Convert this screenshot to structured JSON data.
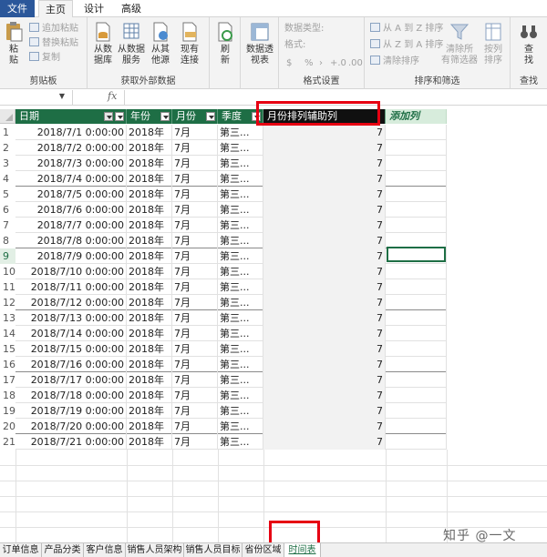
{
  "ribbon_tabs": [
    {
      "label": "文件"
    },
    {
      "label": "主页"
    },
    {
      "label": "设计"
    },
    {
      "label": "高级"
    }
  ],
  "ribbon": {
    "clipboard": {
      "paste_label": "粘",
      "paste_label2": "贴",
      "append_paste": "追加粘贴",
      "replace_paste": "替换粘贴",
      "copy": "复制",
      "group_label": "剪贴板"
    },
    "external": {
      "from_db_1": "从数",
      "from_db_2": "据库",
      "from_data_service_1": "从数据",
      "from_data_service_2": "服务",
      "from_other_1": "从其",
      "from_other_2": "他源",
      "existing_1": "现有",
      "existing_2": "连接",
      "group_label": "获取外部数据"
    },
    "refresh": {
      "label_1": "刷",
      "label_2": "新"
    },
    "pivot": {
      "label_1": "数据透",
      "label_2": "视表"
    },
    "format": {
      "data_type": "数据类型:",
      "format": "格式:",
      "currency": "$",
      "percent": "%",
      "comma": "›",
      "inc": "+.0",
      "dec": ".00",
      "group_label": "格式设置"
    },
    "sort": {
      "a_to_z": "从 A 到 Z 排序",
      "z_to_a": "从 Z 到 A 排序",
      "clear_sort": "清除排序",
      "clear_filters_1": "清除所",
      "clear_filters_2": "有筛选器",
      "sort_by_col_1": "按列",
      "sort_by_col_2": "排序",
      "group_label": "排序和筛选"
    },
    "find": {
      "label_1": "查",
      "label_2": "找",
      "group_label": "查找"
    }
  },
  "formula_bar": {
    "fx": "fx",
    "dropdown": "▼"
  },
  "table": {
    "headers": [
      "日期",
      "年份",
      "月份",
      "季度",
      "月份排列辅助列",
      "添加列"
    ],
    "rows": [
      {
        "n": "1",
        "date": "2018/7/1 0:00:00",
        "year": "2018年",
        "month": "7月",
        "quarter": "第三...",
        "helper": "7"
      },
      {
        "n": "2",
        "date": "2018/7/2 0:00:00",
        "year": "2018年",
        "month": "7月",
        "quarter": "第三...",
        "helper": "7"
      },
      {
        "n": "3",
        "date": "2018/7/3 0:00:00",
        "year": "2018年",
        "month": "7月",
        "quarter": "第三...",
        "helper": "7"
      },
      {
        "n": "4",
        "date": "2018/7/4 0:00:00",
        "year": "2018年",
        "month": "7月",
        "quarter": "第三...",
        "helper": "7"
      },
      {
        "n": "5",
        "date": "2018/7/5 0:00:00",
        "year": "2018年",
        "month": "7月",
        "quarter": "第三...",
        "helper": "7"
      },
      {
        "n": "6",
        "date": "2018/7/6 0:00:00",
        "year": "2018年",
        "month": "7月",
        "quarter": "第三...",
        "helper": "7"
      },
      {
        "n": "7",
        "date": "2018/7/7 0:00:00",
        "year": "2018年",
        "month": "7月",
        "quarter": "第三...",
        "helper": "7"
      },
      {
        "n": "8",
        "date": "2018/7/8 0:00:00",
        "year": "2018年",
        "month": "7月",
        "quarter": "第三...",
        "helper": "7"
      },
      {
        "n": "9",
        "date": "2018/7/9 0:00:00",
        "year": "2018年",
        "month": "7月",
        "quarter": "第三...",
        "helper": "7"
      },
      {
        "n": "10",
        "date": "2018/7/10 0:00:00",
        "year": "2018年",
        "month": "7月",
        "quarter": "第三...",
        "helper": "7"
      },
      {
        "n": "11",
        "date": "2018/7/11 0:00:00",
        "year": "2018年",
        "month": "7月",
        "quarter": "第三...",
        "helper": "7"
      },
      {
        "n": "12",
        "date": "2018/7/12 0:00:00",
        "year": "2018年",
        "month": "7月",
        "quarter": "第三...",
        "helper": "7"
      },
      {
        "n": "13",
        "date": "2018/7/13 0:00:00",
        "year": "2018年",
        "month": "7月",
        "quarter": "第三...",
        "helper": "7"
      },
      {
        "n": "14",
        "date": "2018/7/14 0:00:00",
        "year": "2018年",
        "month": "7月",
        "quarter": "第三...",
        "helper": "7"
      },
      {
        "n": "15",
        "date": "2018/7/15 0:00:00",
        "year": "2018年",
        "month": "7月",
        "quarter": "第三...",
        "helper": "7"
      },
      {
        "n": "16",
        "date": "2018/7/16 0:00:00",
        "year": "2018年",
        "month": "7月",
        "quarter": "第三...",
        "helper": "7"
      },
      {
        "n": "17",
        "date": "2018/7/17 0:00:00",
        "year": "2018年",
        "month": "7月",
        "quarter": "第三...",
        "helper": "7"
      },
      {
        "n": "18",
        "date": "2018/7/18 0:00:00",
        "year": "2018年",
        "month": "7月",
        "quarter": "第三...",
        "helper": "7"
      },
      {
        "n": "19",
        "date": "2018/7/19 0:00:00",
        "year": "2018年",
        "month": "7月",
        "quarter": "第三...",
        "helper": "7"
      },
      {
        "n": "20",
        "date": "2018/7/20 0:00:00",
        "year": "2018年",
        "month": "7月",
        "quarter": "第三...",
        "helper": "7"
      },
      {
        "n": "21",
        "date": "2018/7/21 0:00:00",
        "year": "2018年",
        "month": "7月",
        "quarter": "第三...",
        "helper": "7"
      }
    ],
    "selected_row": "9"
  },
  "sheet_tabs": [
    {
      "label": "订单信息"
    },
    {
      "label": "产品分类"
    },
    {
      "label": "客户信息"
    },
    {
      "label": "销售人员架构"
    },
    {
      "label": "销售人员目标"
    },
    {
      "label": "省份区域"
    },
    {
      "label": "时间表"
    }
  ],
  "active_sheet": "时间表",
  "watermark": "知乎 @一文",
  "colors": {
    "header_green": "#1e6e45",
    "highlight_red": "#e60012",
    "file_tab_blue": "#2b579a"
  }
}
